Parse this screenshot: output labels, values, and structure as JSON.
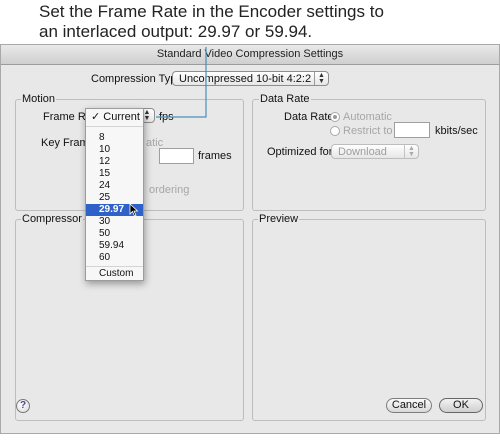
{
  "callout": {
    "line1": "Set the Frame Rate in the Encoder settings to",
    "line2": "an interlaced output: 29.97 or 59.94."
  },
  "window": {
    "title": "Standard Video Compression Settings"
  },
  "compression_type": {
    "label": "Compression Type:",
    "value": "Uncompressed 10-bit 4:2:2"
  },
  "motion": {
    "title": "Motion",
    "frame_rate_label": "Frame Rate",
    "frame_rate_value": "Current",
    "fps_label": "fps",
    "key_frames_label": "Key Frames",
    "key_frames_auto_fragment": "atic",
    "frames_label": "frames",
    "reordering_fragment": "ordering"
  },
  "frame_rate_menu": {
    "checkmark": "✓",
    "checked_item": "Current",
    "items": [
      "8",
      "10",
      "12",
      "15",
      "24",
      "25",
      "29.97",
      "30",
      "50",
      "59.94",
      "60"
    ],
    "selected": "29.97",
    "custom": "Custom"
  },
  "data_rate": {
    "title": "Data Rate",
    "label": "Data Rate:",
    "automatic": "Automatic",
    "restrict": "Restrict to",
    "unit": "kbits/sec",
    "optimized_label": "Optimized for:",
    "optimized_value": "Download"
  },
  "compressor": {
    "title": "Compressor"
  },
  "preview": {
    "title": "Preview"
  },
  "buttons": {
    "cancel": "Cancel",
    "ok": "OK",
    "help": "?"
  },
  "colors": {
    "accent": "#2f62c9",
    "callout_line": "#4a90b8"
  }
}
